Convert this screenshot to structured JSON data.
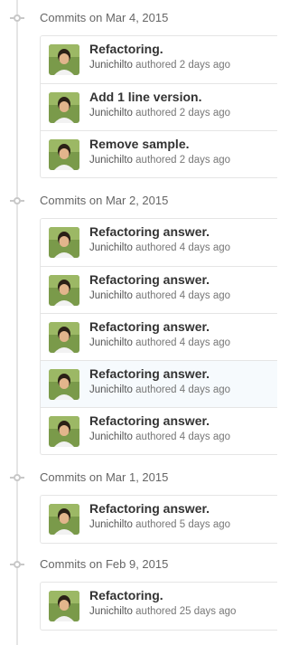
{
  "groups": [
    {
      "title": "Commits on Mar 4, 2015",
      "commits": [
        {
          "title": "Refactoring.",
          "author": "Junichilto",
          "meta": "authored 2 days ago"
        },
        {
          "title": "Add 1 line version.",
          "author": "Junichilto",
          "meta": "authored 2 days ago"
        },
        {
          "title": "Remove sample.",
          "author": "Junichilto",
          "meta": "authored 2 days ago"
        }
      ]
    },
    {
      "title": "Commits on Mar 2, 2015",
      "commits": [
        {
          "title": "Refactoring answer.",
          "author": "Junichilto",
          "meta": "authored 4 days ago"
        },
        {
          "title": "Refactoring answer.",
          "author": "Junichilto",
          "meta": "authored 4 days ago"
        },
        {
          "title": "Refactoring answer.",
          "author": "Junichilto",
          "meta": "authored 4 days ago"
        },
        {
          "title": "Refactoring answer.",
          "author": "Junichilto",
          "meta": "authored 4 days ago"
        },
        {
          "title": "Refactoring answer.",
          "author": "Junichilto",
          "meta": "authored 4 days ago"
        }
      ]
    },
    {
      "title": "Commits on Mar 1, 2015",
      "commits": [
        {
          "title": "Refactoring answer.",
          "author": "Junichilto",
          "meta": "authored 5 days ago"
        }
      ]
    },
    {
      "title": "Commits on Feb 9, 2015",
      "commits": [
        {
          "title": "Refactoring.",
          "author": "Junichilto",
          "meta": "authored 25 days ago"
        }
      ]
    }
  ],
  "colors": {
    "timeline": "#e5e5e5",
    "node": "#c8c8c8",
    "title": "#333333",
    "meta": "#777777",
    "highlight_row": "#f6fafd"
  },
  "icons": {
    "commit_node": "git-commit-icon",
    "avatar": "user-avatar"
  }
}
